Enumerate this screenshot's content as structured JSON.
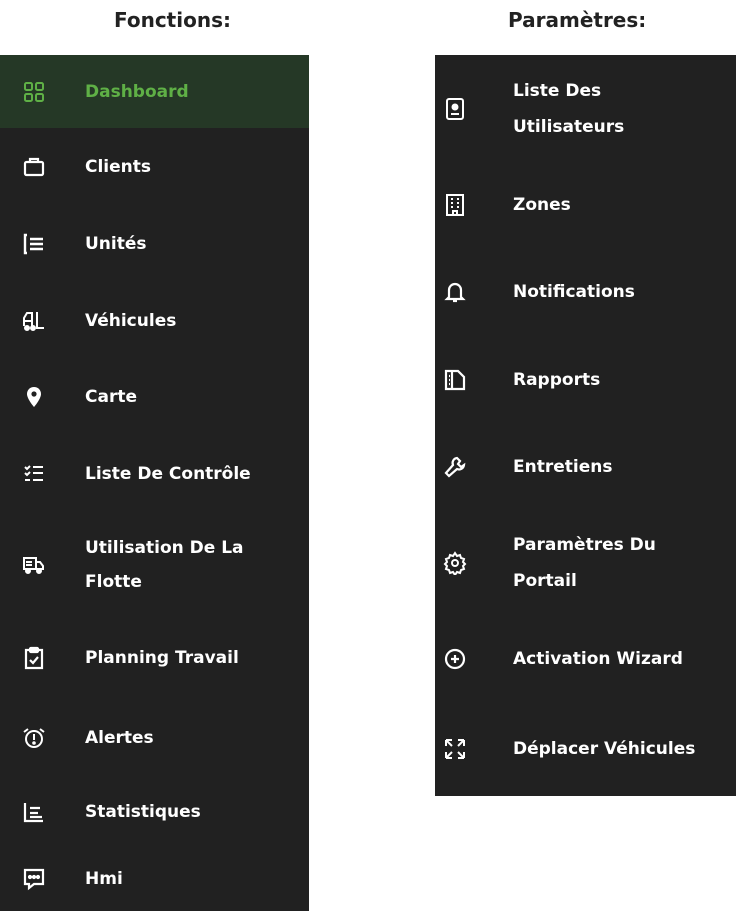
{
  "columns": {
    "left_title": "Fonctions:",
    "right_title": "Paramètres:"
  },
  "fonctions": [
    {
      "label": "Dashboard",
      "icon": "dashboard-icon",
      "active": true
    },
    {
      "label": "Clients",
      "icon": "briefcase-icon"
    },
    {
      "label": "Unités",
      "icon": "list-icon"
    },
    {
      "label": "Véhicules",
      "icon": "forklift-icon"
    },
    {
      "label": "Carte",
      "icon": "map-pin-icon"
    },
    {
      "label": "Liste De Contrôle",
      "icon": "checklist-icon"
    },
    {
      "label": "Utilisation De La Flotte",
      "icon": "truck-icon"
    },
    {
      "label": "Planning Travail",
      "icon": "clipboard-check-icon"
    },
    {
      "label": "Alertes",
      "icon": "alarm-icon"
    },
    {
      "label": "Statistiques",
      "icon": "bar-chart-icon"
    },
    {
      "label": "Hmi",
      "icon": "chat-icon"
    }
  ],
  "parametres": [
    {
      "label": "Liste Des Utilisateurs",
      "icon": "id-badge-icon"
    },
    {
      "label": "Zones",
      "icon": "building-icon"
    },
    {
      "label": "Notifications",
      "icon": "bell-icon"
    },
    {
      "label": "Rapports",
      "icon": "report-icon"
    },
    {
      "label": "Entretiens",
      "icon": "wrench-icon"
    },
    {
      "label": "Paramètres Du Portail",
      "icon": "gear-icon"
    },
    {
      "label": "Activation Wizard",
      "icon": "plus-circle-icon"
    },
    {
      "label": "Déplacer Véhicules",
      "icon": "move-icon"
    }
  ],
  "colors": {
    "panel_bg": "#212121",
    "active_bg": "#253826",
    "active_text": "#5fb046",
    "text": "#ffffff"
  }
}
